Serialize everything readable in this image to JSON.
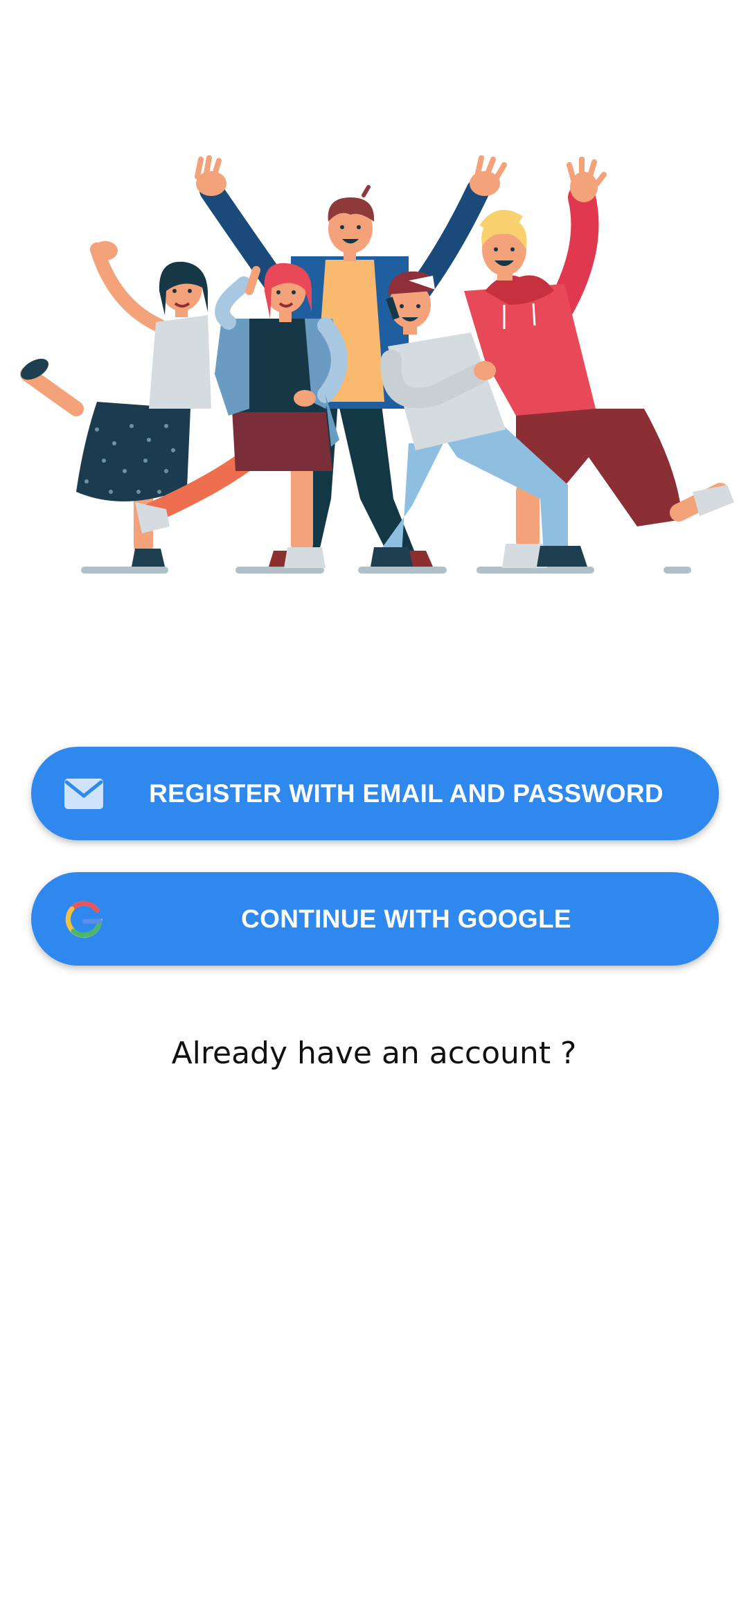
{
  "colors": {
    "accent": "#2F88EE",
    "text_dark": "#111111",
    "background": "#FFFFFF"
  },
  "hero": {
    "illustration": "group-of-friends-cheering-illustration"
  },
  "actions": {
    "email": {
      "label": "REGISTER WITH EMAIL AND PASSWORD",
      "icon": "envelope-icon"
    },
    "google": {
      "label": "CONTINUE WITH GOOGLE",
      "icon": "google-logo-icon"
    }
  },
  "footer": {
    "login_prompt": "Already have an account ?"
  }
}
